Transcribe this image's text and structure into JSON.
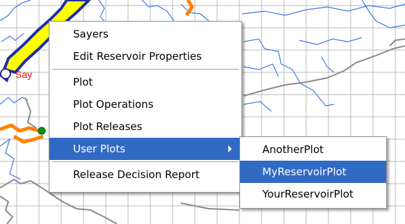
{
  "map": {
    "label": "Say",
    "colors": {
      "grid": "#b8b8b8",
      "river": "#3b78e8",
      "reservoir_fill": "#ffff00",
      "reservoir_outline": "#1c2fa6",
      "orange": "#ff8000",
      "boundary": "#8a8a8a",
      "node": "#009900",
      "label": "#ff0000"
    }
  },
  "context_menu": {
    "items": [
      {
        "label": "Sayers"
      },
      {
        "label": "Edit Reservoir Properties"
      },
      {
        "label": "Plot"
      },
      {
        "label": "Plot Operations"
      },
      {
        "label": "Plot Releases"
      },
      {
        "label": "User Plots",
        "highlighted": true,
        "has_submenu": true
      },
      {
        "label": "Release Decision Report"
      }
    ],
    "colors": {
      "highlight": "#316ac5",
      "border": "#8d8d8d"
    }
  },
  "submenu": {
    "items": [
      {
        "label": "AnotherPlot"
      },
      {
        "label": "MyReservoirPlot",
        "highlighted": true
      },
      {
        "label": "YourReservoirPlot"
      }
    ]
  }
}
